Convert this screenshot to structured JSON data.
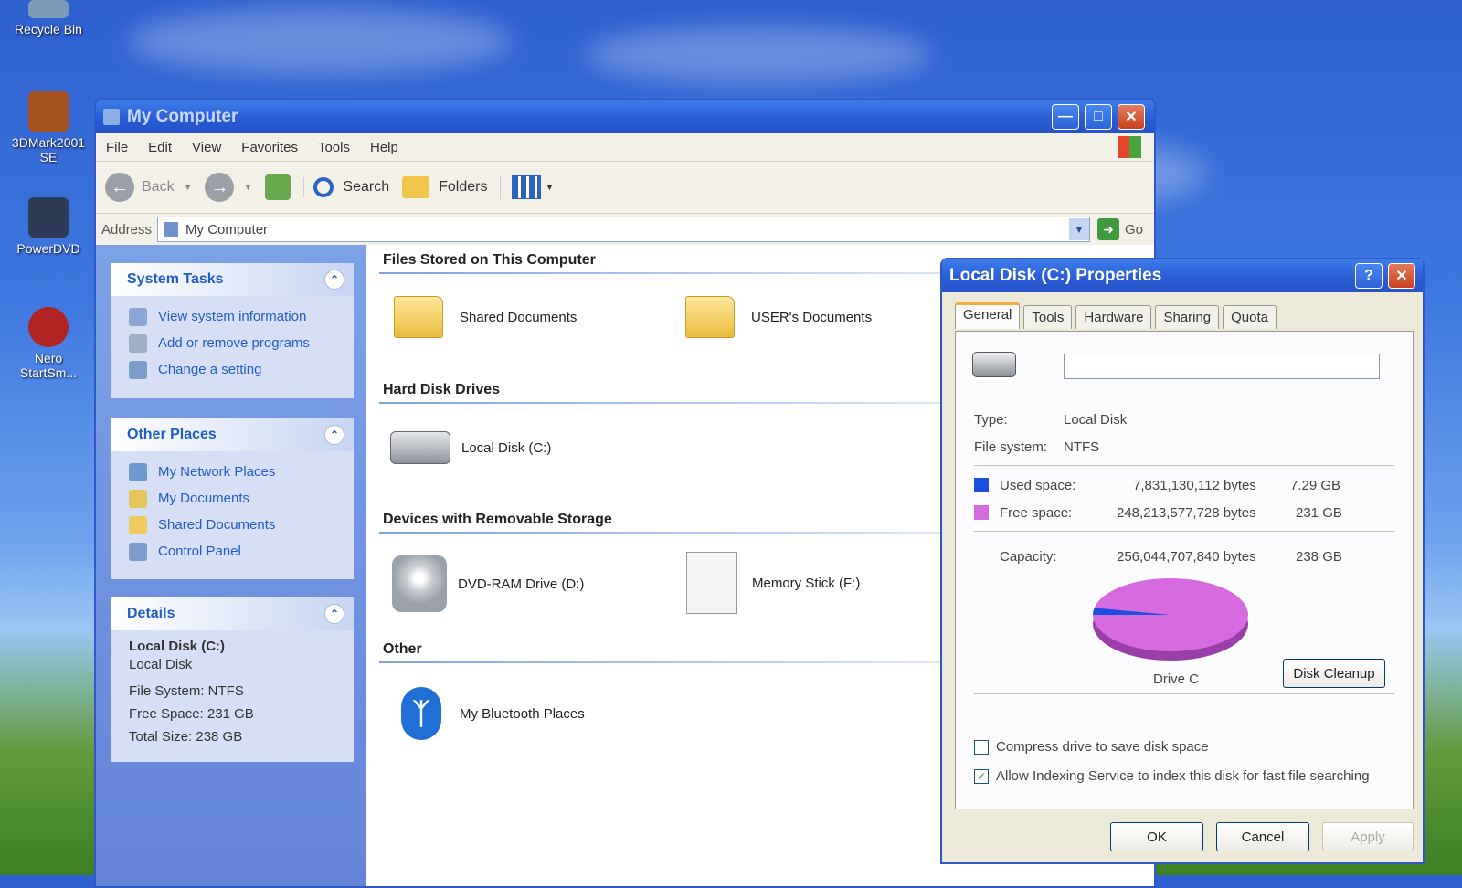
{
  "desktop": {
    "icons": [
      "Recycle Bin",
      "3DMark2001 SE",
      "PowerDVD",
      "Nero StartSm..."
    ]
  },
  "window": {
    "title": "My Computer",
    "menu": [
      "File",
      "Edit",
      "View",
      "Favorites",
      "Tools",
      "Help"
    ],
    "toolbar": {
      "back": "Back",
      "search": "Search",
      "folders": "Folders"
    },
    "address_label": "Address",
    "address_value": "My Computer",
    "go_label": "Go"
  },
  "left_pane": {
    "system_tasks": {
      "title": "System Tasks",
      "items": [
        "View system information",
        "Add or remove programs",
        "Change a setting"
      ]
    },
    "other_places": {
      "title": "Other Places",
      "items": [
        "My Network Places",
        "My Documents",
        "Shared Documents",
        "Control Panel"
      ]
    },
    "details": {
      "title": "Details",
      "name": "Local Disk (C:)",
      "type": "Local Disk",
      "file_system": "File System: NTFS",
      "free_space": "Free Space: 231 GB",
      "total_size": "Total Size: 238 GB"
    }
  },
  "content": {
    "groups": [
      {
        "title": "Files Stored on This Computer",
        "items": [
          "Shared Documents",
          "USER's Documents"
        ]
      },
      {
        "title": "Hard Disk Drives",
        "items": [
          "Local Disk (C:)"
        ]
      },
      {
        "title": "Devices with Removable Storage",
        "items": [
          "DVD-RAM Drive (D:)",
          "Memory Stick (F:)"
        ]
      },
      {
        "title": "Other",
        "items": [
          "My Bluetooth Places"
        ]
      }
    ]
  },
  "dialog": {
    "title": "Local Disk (C:) Properties",
    "help": "?",
    "tabs": [
      "General",
      "Tools",
      "Hardware",
      "Sharing",
      "Quota"
    ],
    "label_value": "",
    "type_label": "Type:",
    "type_value": "Local Disk",
    "fs_label": "File system:",
    "fs_value": "NTFS",
    "used_label": "Used space:",
    "used_bytes": "7,831,130,112 bytes",
    "used_gb": "7.29 GB",
    "free_label": "Free space:",
    "free_bytes": "248,213,577,728 bytes",
    "free_gb": "231 GB",
    "cap_label": "Capacity:",
    "cap_bytes": "256,044,707,840 bytes",
    "cap_gb": "238 GB",
    "drive_label": "Drive C",
    "cleanup": "Disk Cleanup",
    "compress": "Compress drive to save disk space",
    "compress_checked": false,
    "indexing": "Allow Indexing Service to index this disk for fast file searching",
    "indexing_checked": true,
    "ok": "OK",
    "cancel": "Cancel",
    "apply": "Apply",
    "used_fraction": 0.0306,
    "colors": {
      "used": "#1a4fe0",
      "free": "#d66be0"
    }
  }
}
